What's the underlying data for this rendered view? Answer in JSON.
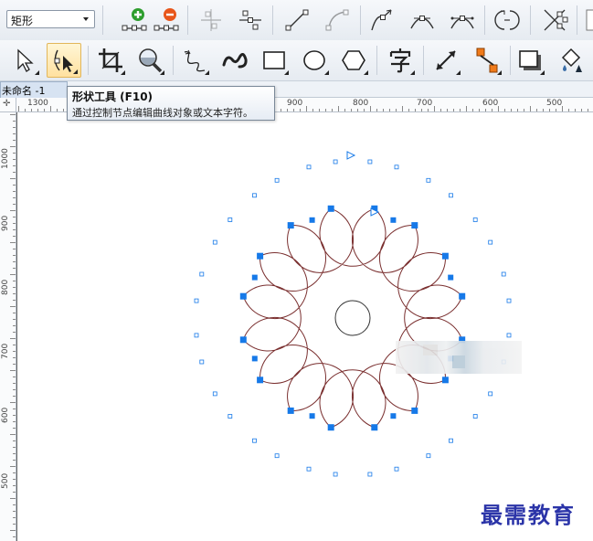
{
  "toolbar_top": {
    "object_dropdown": {
      "value": "矩形"
    }
  },
  "document": {
    "tab_label": "未命名 -1"
  },
  "tooltip": {
    "title": "形状工具 (F10)",
    "description": "通过控制节点编辑曲线对象或文本字符。"
  },
  "ruler": {
    "horizontal_labels": [
      "1300",
      "900",
      "800",
      "700",
      "600",
      "500"
    ],
    "vertical_labels": [
      "1000",
      "900",
      "800",
      "700",
      "600",
      "500"
    ]
  },
  "watermark": "最需教育",
  "colors": {
    "node_fill": "#1679e8",
    "curve_stroke": "#7a2f2f",
    "tool_active": "#ffe1a0",
    "watermark": "#2b34a8"
  },
  "icons": {
    "add_node": "add-node-icon",
    "delete_node": "delete-node-icon",
    "shape_tool": "shape-tool-icon",
    "pick_tool": "pick-tool-icon",
    "crop_tool": "crop-tool-icon",
    "zoom_tool": "zoom-tool-icon",
    "freehand_tool": "freehand-tool-icon",
    "smart_draw_tool": "smart-draw-tool-icon",
    "rectangle_tool": "rectangle-tool-icon",
    "ellipse_tool": "ellipse-tool-icon",
    "polygon_tool": "polygon-tool-icon",
    "text_tool": "text-tool-icon",
    "dimension_tool": "dimension-tool-icon",
    "connector_tool": "connector-tool-icon",
    "drop_shadow_tool": "drop-shadow-tool-icon",
    "fill_tool": "fill-tool-icon"
  }
}
